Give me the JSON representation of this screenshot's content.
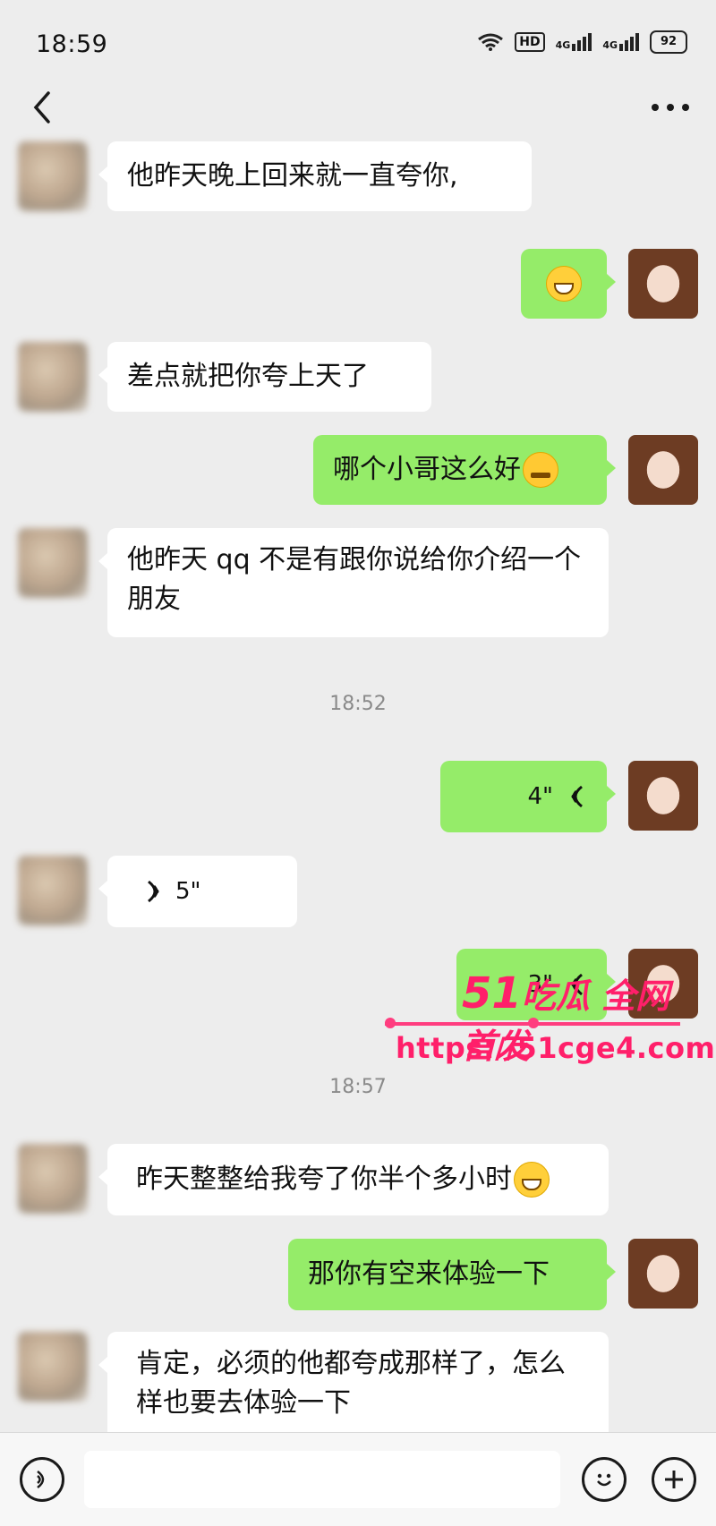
{
  "status": {
    "time": "18:59",
    "hd_label": "HD",
    "net1": "4G",
    "net2": "4G",
    "battery": "92"
  },
  "watermark": {
    "brand": "吃瓜 全网首发",
    "brand_num": "51",
    "url": "https://51cge4.com"
  },
  "messages": [
    {
      "text": "他昨天晚上回来就一直夸你,"
    },
    {
      "emoji": "grin"
    },
    {
      "text": "差点就把你夸上天了"
    },
    {
      "text": "哪个小哥这么好",
      "emoji": "thinking"
    },
    {
      "text": "他昨天 qq 不是有跟你说给你介绍一个朋友"
    },
    {
      "timestamp": "18:52"
    },
    {
      "voice": "4\""
    },
    {
      "voice": "5\""
    },
    {
      "voice": "3\""
    },
    {
      "timestamp": "18:57"
    },
    {
      "text": "昨天整整给我夸了你半个多小时",
      "emoji": "grin"
    },
    {
      "text": "那你有空来体验一下"
    },
    {
      "text": "肯定，必须的他都夸成那样了，怎么样也要去体验一下"
    }
  ],
  "icons": {
    "back": "chevron-left-icon",
    "more": "more-icon",
    "voice_input": "voice-input-icon",
    "emoji": "emoji-icon",
    "add": "plus-icon"
  }
}
